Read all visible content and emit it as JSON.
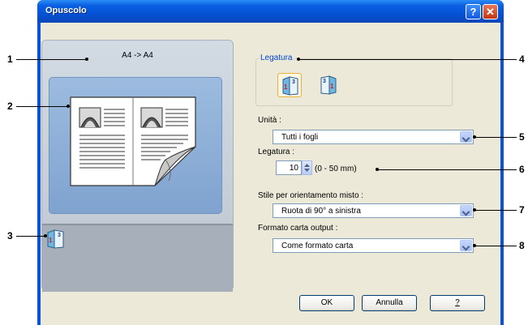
{
  "window": {
    "title": "Opuscolo",
    "help_glyph": "?",
    "close_glyph": "✕"
  },
  "preview": {
    "size_label": "A4 -> A4"
  },
  "binding": {
    "group_label": "Legatura",
    "options": [
      {
        "icon": "left-binding-icon",
        "selected": true
      },
      {
        "icon": "right-binding-icon",
        "selected": false
      }
    ]
  },
  "fields": {
    "unit_label": "Unità :",
    "unit_value": "Tutti i fogli",
    "binding_margin_label": "Legatura :",
    "binding_margin_value": "10",
    "binding_margin_range": "(0 - 50 mm)",
    "mixed_orientation_label": "Stile per orientamento misto :",
    "mixed_orientation_value": "Ruota di 90° a sinistra",
    "output_paper_label": "Formato carta output :",
    "output_paper_value": "Come formato carta"
  },
  "buttons": {
    "ok": "OK",
    "cancel": "Annulla",
    "help": "?"
  },
  "callouts": [
    "1",
    "2",
    "3",
    "4",
    "5",
    "6",
    "7",
    "8"
  ]
}
